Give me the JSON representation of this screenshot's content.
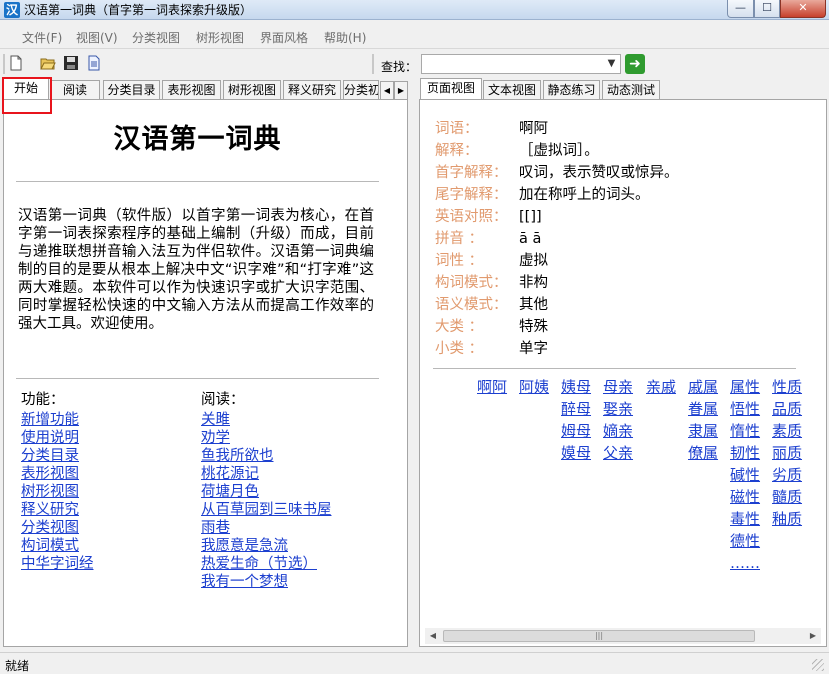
{
  "window": {
    "title": "汉语第一词典（首字第一词表探索升级版）",
    "app_icon_char": "汉",
    "minimize_glyph": "—",
    "maximize_glyph": "☐",
    "close_glyph": "✕"
  },
  "menu": [
    "文件(F)",
    "视图(V)",
    "分类视图",
    "树形视图",
    "界面风格",
    "帮助(H)"
  ],
  "toolbar": {
    "icons": [
      "new-file-icon",
      "open-folder-icon",
      "save-icon",
      "document-icon"
    ],
    "search_label": "查找：",
    "search_value": "",
    "go_icon": "arrow-right-icon",
    "go_glyph": "➜"
  },
  "left_tabs": [
    "开始",
    "阅读",
    "分类目录",
    "表形视图",
    "树形视图",
    "释义研究",
    "分类初"
  ],
  "left_tab_active": 0,
  "tab_scroll": {
    "left": "◀",
    "right": "▶"
  },
  "right_tabs": [
    "页面视图",
    "文本视图",
    "静态练习",
    "动态测试"
  ],
  "right_tab_active": 0,
  "left_panel": {
    "title": "汉语第一词典",
    "intro": "汉语第一词典（软件版）以首字第一词表为核心，在首字第一词表探索程序的基础上编制（升级）而成，目前与递推联想拼音输入法互为伴侣软件。汉语第一词典编制的目的是要从根本上解决中文“识字难”和“打字难”这两大难题。本软件可以作为快速识字或扩大识字范围、同时掌握轻松快速的中文输入方法从而提高工作效率的强大工具。欢迎使用。",
    "features_heading": "功能：",
    "features": [
      "新增功能",
      "使用说明",
      "分类目录",
      "表形视图",
      "树形视图",
      "释义研究",
      "分类视图",
      "构词模式",
      "中华字词经"
    ],
    "reading_heading": "阅读：",
    "reading": [
      "关雎",
      "劝学",
      "鱼我所欲也",
      "桃花源记",
      "荷塘月色",
      "从百草园到三味书屋",
      "雨巷",
      "我愿意是急流",
      "热爱生命（节选）",
      "我有一个梦想"
    ]
  },
  "right_panel": {
    "fields": [
      {
        "key": "词语：",
        "value": "啊阿"
      },
      {
        "key": "解释：",
        "value": "［虚拟词］。"
      },
      {
        "key": "首字解释：",
        "value": "叹词，表示赞叹或惊异。"
      },
      {
        "key": "尾字解释：",
        "value": "加在称呼上的词头。"
      },
      {
        "key": "英语对照：",
        "value": "[[]]"
      },
      {
        "key": "拼音  ：",
        "value": "ā ā"
      },
      {
        "key": "词性  ：",
        "value": "虚拟"
      },
      {
        "key": "构词模式：",
        "value": "非构"
      },
      {
        "key": "语义模式：",
        "value": "其他"
      },
      {
        "key": "大类  ：",
        "value": "特殊"
      },
      {
        "key": "小类  ：",
        "value": "单字"
      }
    ],
    "word_columns": [
      [
        "啊阿"
      ],
      [
        "阿姨"
      ],
      [
        "姨母",
        "醉母",
        "姆母",
        "嫫母"
      ],
      [
        "母亲",
        "娶亲",
        "嫡亲",
        "父亲"
      ],
      [
        "亲戚"
      ],
      [
        "戚属",
        "眷属",
        "隶属",
        "僚属"
      ],
      [
        "属性",
        "悟性",
        "惰性",
        "韧性",
        "碱性",
        "磁性",
        "毒性",
        "德性",
        "……"
      ],
      [
        "性质",
        "品质",
        "素质",
        "丽质",
        "劣质",
        "髓质",
        "釉质"
      ]
    ]
  },
  "hscroll": {
    "left": "◀",
    "right": "▶",
    "grip": "|||"
  },
  "status": "就绪",
  "colors": {
    "label": "#e19a6e",
    "link": "#1c3fcf",
    "highlight": "#e8141c",
    "go": "#2f9b2f"
  }
}
